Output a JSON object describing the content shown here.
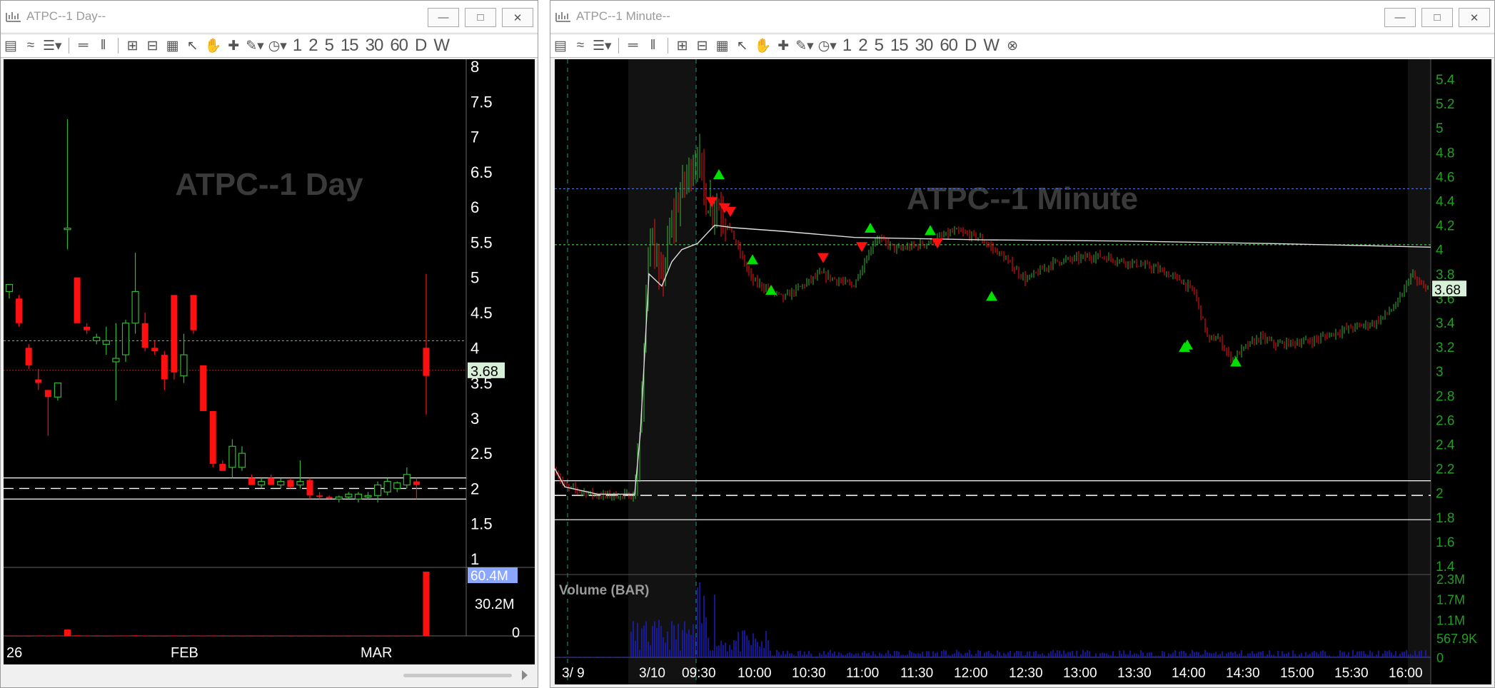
{
  "day_window": {
    "title": "ATPC--1 Day--",
    "watermark": "ATPC--1 Day",
    "price_tag": "3.68",
    "volume_tag": "60.4M",
    "price_ticks": [
      "8",
      "7.5",
      "7",
      "6.5",
      "6",
      "5.5",
      "5",
      "4.5",
      "4",
      "3.5",
      "3",
      "2.5",
      "2",
      "1.5",
      "1"
    ],
    "volume_ticks": [
      "30.2M",
      "0"
    ],
    "date_labels": [
      "26",
      "FEB",
      "MAR"
    ],
    "toolbar_numbers": [
      "1",
      "2",
      "5",
      "15",
      "30",
      "60",
      "D",
      "W"
    ]
  },
  "minute_window": {
    "title": "ATPC--1 Minute--",
    "watermark": "ATPC--1 Minute",
    "price_tag": "3.68",
    "volume_title": "Volume (BAR)",
    "price_ticks": [
      "5.4",
      "5.2",
      "5",
      "4.8",
      "4.6",
      "4.4",
      "4.2",
      "4",
      "3.8",
      "3.6",
      "3.4",
      "3.2",
      "3",
      "2.8",
      "2.6",
      "2.4",
      "2.2",
      "2",
      "1.8",
      "1.6",
      "1.4"
    ],
    "volume_ticks": [
      "2.3M",
      "1.7M",
      "1.1M",
      "567.9K",
      "0"
    ],
    "time_labels": [
      "3/ 9",
      "3/10",
      "09:30",
      "10:00",
      "10:30",
      "11:00",
      "11:30",
      "12:00",
      "12:30",
      "13:00",
      "13:30",
      "14:00",
      "14:30",
      "15:00",
      "15:30",
      "16:00"
    ],
    "toolbar_numbers": [
      "1",
      "2",
      "5",
      "15",
      "30",
      "60",
      "D",
      "W"
    ]
  },
  "colors": {
    "up": "#35b535",
    "down": "#ff1010",
    "vwap": "#e0e0e0",
    "green_level": "#30d030",
    "blue_level": "#3a70ff",
    "axis_text_day": "#ffffff",
    "axis_text_min": "#1fa01f",
    "volume_bar": "#2020d0"
  },
  "chart_data": [
    {
      "type": "candlestick",
      "title": "ATPC--1 Day",
      "ylim": [
        1,
        8
      ],
      "x_labels": [
        "26",
        "FEB",
        "MAR"
      ],
      "last_price": 3.68,
      "levels": [
        4.1,
        3.68,
        2.15,
        2.0,
        1.85
      ],
      "candles": [
        {
          "o": 4.8,
          "h": 4.9,
          "l": 4.7,
          "c": 4.9
        },
        {
          "o": 4.7,
          "h": 4.75,
          "l": 4.3,
          "c": 4.35
        },
        {
          "o": 4.0,
          "h": 4.05,
          "l": 3.7,
          "c": 3.75
        },
        {
          "o": 3.55,
          "h": 3.7,
          "l": 3.4,
          "c": 3.5
        },
        {
          "o": 3.4,
          "h": 3.4,
          "l": 2.75,
          "c": 3.3
        },
        {
          "o": 3.3,
          "h": 3.5,
          "l": 3.25,
          "c": 3.5
        },
        {
          "o": 5.7,
          "h": 7.25,
          "l": 5.4,
          "c": 5.7
        },
        {
          "o": 5.0,
          "h": 5.0,
          "l": 4.4,
          "c": 4.35
        },
        {
          "o": 4.3,
          "h": 4.35,
          "l": 4.2,
          "c": 4.25
        },
        {
          "o": 4.1,
          "h": 4.2,
          "l": 4.05,
          "c": 4.15
        },
        {
          "o": 4.05,
          "h": 4.3,
          "l": 3.9,
          "c": 4.1
        },
        {
          "o": 3.8,
          "h": 4.35,
          "l": 3.25,
          "c": 3.85
        },
        {
          "o": 3.9,
          "h": 4.4,
          "l": 3.8,
          "c": 4.35
        },
        {
          "o": 4.35,
          "h": 5.35,
          "l": 4.2,
          "c": 4.8
        },
        {
          "o": 4.35,
          "h": 4.5,
          "l": 3.95,
          "c": 4.0
        },
        {
          "o": 4.0,
          "h": 4.1,
          "l": 3.9,
          "c": 3.95
        },
        {
          "o": 3.9,
          "h": 3.95,
          "l": 3.4,
          "c": 3.55
        },
        {
          "o": 4.75,
          "h": 4.75,
          "l": 3.55,
          "c": 3.65
        },
        {
          "o": 3.6,
          "h": 4.2,
          "l": 3.5,
          "c": 3.9
        },
        {
          "o": 4.75,
          "h": 4.75,
          "l": 4.2,
          "c": 4.25
        },
        {
          "o": 3.75,
          "h": 3.75,
          "l": 3.1,
          "c": 3.1
        },
        {
          "o": 3.1,
          "h": 3.1,
          "l": 2.3,
          "c": 2.35
        },
        {
          "o": 2.35,
          "h": 2.4,
          "l": 2.25,
          "c": 2.25
        },
        {
          "o": 2.3,
          "h": 2.7,
          "l": 2.15,
          "c": 2.6
        },
        {
          "o": 2.3,
          "h": 2.6,
          "l": 2.25,
          "c": 2.5
        },
        {
          "o": 2.15,
          "h": 2.2,
          "l": 2.05,
          "c": 2.05
        },
        {
          "o": 2.05,
          "h": 2.15,
          "l": 2.0,
          "c": 2.1
        },
        {
          "o": 2.15,
          "h": 2.2,
          "l": 2.05,
          "c": 2.05
        },
        {
          "o": 2.05,
          "h": 2.15,
          "l": 2.0,
          "c": 2.1
        },
        {
          "o": 2.12,
          "h": 2.15,
          "l": 2.0,
          "c": 2.02
        },
        {
          "o": 2.05,
          "h": 2.4,
          "l": 2.0,
          "c": 2.1
        },
        {
          "o": 2.12,
          "h": 2.15,
          "l": 1.85,
          "c": 1.9
        },
        {
          "o": 1.9,
          "h": 1.95,
          "l": 1.85,
          "c": 1.88
        },
        {
          "o": 1.88,
          "h": 1.9,
          "l": 1.85,
          "c": 1.87
        },
        {
          "o": 1.85,
          "h": 1.9,
          "l": 1.8,
          "c": 1.88
        },
        {
          "o": 1.88,
          "h": 1.95,
          "l": 1.85,
          "c": 1.92
        },
        {
          "o": 1.85,
          "h": 1.95,
          "l": 1.8,
          "c": 1.92
        },
        {
          "o": 1.88,
          "h": 1.95,
          "l": 1.85,
          "c": 1.9
        },
        {
          "o": 1.9,
          "h": 2.1,
          "l": 1.8,
          "c": 2.05
        },
        {
          "o": 1.95,
          "h": 2.15,
          "l": 1.9,
          "c": 2.1
        },
        {
          "o": 2.0,
          "h": 2.1,
          "l": 1.95,
          "c": 2.08
        },
        {
          "o": 2.05,
          "h": 2.3,
          "l": 2.0,
          "c": 2.2
        },
        {
          "o": 2.1,
          "h": 2.15,
          "l": 1.85,
          "c": 2.05
        },
        {
          "o": 4.0,
          "h": 5.05,
          "l": 3.05,
          "c": 3.6
        }
      ],
      "volume": {
        "max": 60.4,
        "unit": "M",
        "values": [
          0.2,
          0.2,
          0.2,
          0.3,
          0.3,
          0.3,
          6.0,
          0.5,
          0.3,
          0.2,
          0.2,
          0.3,
          0.3,
          0.5,
          0.3,
          0.2,
          0.2,
          0.4,
          0.2,
          0.3,
          0.3,
          0.3,
          0.2,
          0.2,
          0.2,
          0.2,
          0.2,
          0.2,
          0.2,
          0.2,
          0.2,
          0.2,
          0.2,
          0.2,
          0.2,
          0.2,
          0.2,
          0.2,
          0.2,
          0.2,
          0.2,
          0.2,
          0.2,
          60.4
        ]
      }
    },
    {
      "type": "candlestick",
      "title": "ATPC--1 Minute",
      "ylim": [
        1.4,
        5.4
      ],
      "x_labels": [
        "3/ 9",
        "3/10",
        "09:30",
        "10:00",
        "10:30",
        "11:00",
        "11:30",
        "12:00",
        "12:30",
        "13:00",
        "13:30",
        "14:00",
        "14:30",
        "15:00",
        "15:30",
        "16:00"
      ],
      "last_price": 3.68,
      "levels": {
        "blue_dotted": 4.5,
        "green_dotted": 4.04,
        "white_upper": 2.1,
        "white_dashed": 1.98,
        "white_lower": 1.78
      },
      "path_keypoints": [
        [
          0,
          2.2
        ],
        [
          14,
          2.05
        ],
        [
          60,
          1.98
        ],
        [
          112,
          1.98
        ],
        [
          123,
          2.8
        ],
        [
          132,
          4.2
        ],
        [
          148,
          3.7
        ],
        [
          164,
          4.2
        ],
        [
          178,
          4.5
        ],
        [
          200,
          4.8
        ],
        [
          212,
          4.4
        ],
        [
          232,
          4.35
        ],
        [
          276,
          3.75
        ],
        [
          320,
          3.6
        ],
        [
          372,
          3.8
        ],
        [
          418,
          3.7
        ],
        [
          450,
          4.1
        ],
        [
          480,
          4.0
        ],
        [
          520,
          4.05
        ],
        [
          560,
          4.15
        ],
        [
          594,
          4.1
        ],
        [
          626,
          3.95
        ],
        [
          660,
          3.75
        ],
        [
          700,
          3.9
        ],
        [
          760,
          3.95
        ],
        [
          840,
          3.85
        ],
        [
          876,
          3.75
        ],
        [
          896,
          3.65
        ],
        [
          916,
          3.25
        ],
        [
          928,
          3.28
        ],
        [
          948,
          3.1
        ],
        [
          968,
          3.2
        ],
        [
          988,
          3.28
        ],
        [
          1010,
          3.22
        ],
        [
          1060,
          3.25
        ],
        [
          1110,
          3.35
        ],
        [
          1150,
          3.4
        ],
        [
          1180,
          3.55
        ],
        [
          1200,
          3.8
        ],
        [
          1212,
          3.7
        ],
        [
          1227,
          3.7
        ]
      ],
      "vwap_keypoints": [
        [
          0,
          2.2
        ],
        [
          14,
          2.05
        ],
        [
          60,
          1.99
        ],
        [
          112,
          1.99
        ],
        [
          120,
          2.5
        ],
        [
          132,
          3.8
        ],
        [
          150,
          3.7
        ],
        [
          164,
          3.9
        ],
        [
          178,
          4.0
        ],
        [
          200,
          4.05
        ],
        [
          224,
          4.2
        ],
        [
          250,
          4.18
        ],
        [
          320,
          4.15
        ],
        [
          420,
          4.1
        ],
        [
          600,
          4.08
        ],
        [
          800,
          4.07
        ],
        [
          1000,
          4.05
        ],
        [
          1227,
          4.02
        ]
      ],
      "buy_signals": [
        [
          230,
          4.62
        ],
        [
          277,
          3.92
        ],
        [
          303,
          3.67
        ],
        [
          442,
          4.18
        ],
        [
          526,
          4.16
        ],
        [
          612,
          3.62
        ],
        [
          882,
          3.2
        ],
        [
          886,
          3.22
        ],
        [
          954,
          3.08
        ]
      ],
      "sell_signals": [
        [
          220,
          4.39
        ],
        [
          238,
          4.34
        ],
        [
          246,
          4.31
        ],
        [
          376,
          3.93
        ],
        [
          430,
          4.02
        ],
        [
          536,
          4.05
        ]
      ],
      "volume": {
        "max_label": "2.3M",
        "ticks_m": [
          2.3,
          1.7,
          1.1,
          0.5679,
          0
        ]
      }
    }
  ]
}
